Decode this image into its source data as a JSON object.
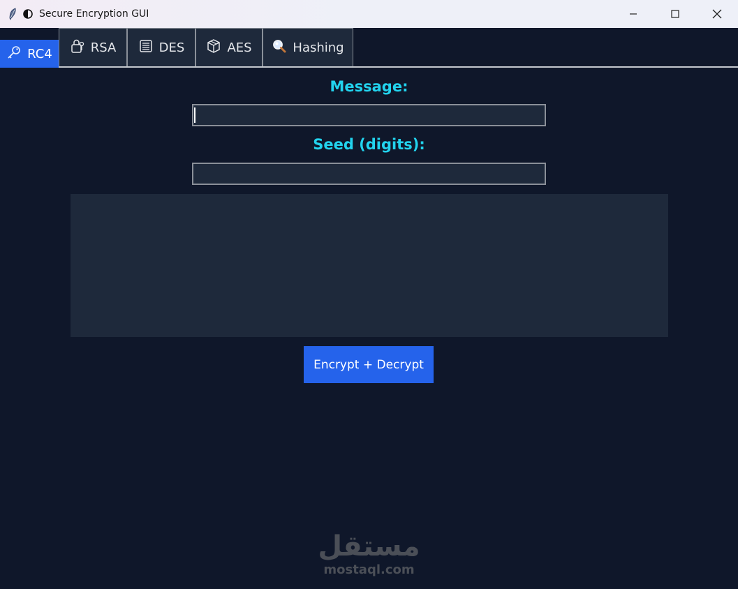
{
  "window": {
    "title": "Secure Encryption GUI",
    "icons": [
      "feather-icon",
      "shield-half-icon"
    ],
    "controls": [
      "minimize-icon",
      "maximize-icon",
      "close-icon"
    ]
  },
  "tabs": [
    {
      "label": "RC4",
      "icon": "key-icon",
      "active": true
    },
    {
      "label": "RSA",
      "icon": "lock-with-key-icon",
      "active": false
    },
    {
      "label": "DES",
      "icon": "memo-icon",
      "active": false
    },
    {
      "label": "AES",
      "icon": "box-icon",
      "active": false
    },
    {
      "label": "Hashing",
      "icon": "magnifier-icon",
      "active": false
    }
  ],
  "form": {
    "message_label": "Message:",
    "message_value": "",
    "seed_label": "Seed (digits):",
    "seed_value": "",
    "output_text": "",
    "button_label": "Encrypt + Decrypt"
  },
  "watermark": {
    "arabic": "مستقل",
    "latin": "mostaql.com"
  },
  "colors": {
    "background": "#0f172a",
    "panel": "#1e293b",
    "accent": "#2563eb",
    "label": "#22d3ee"
  }
}
